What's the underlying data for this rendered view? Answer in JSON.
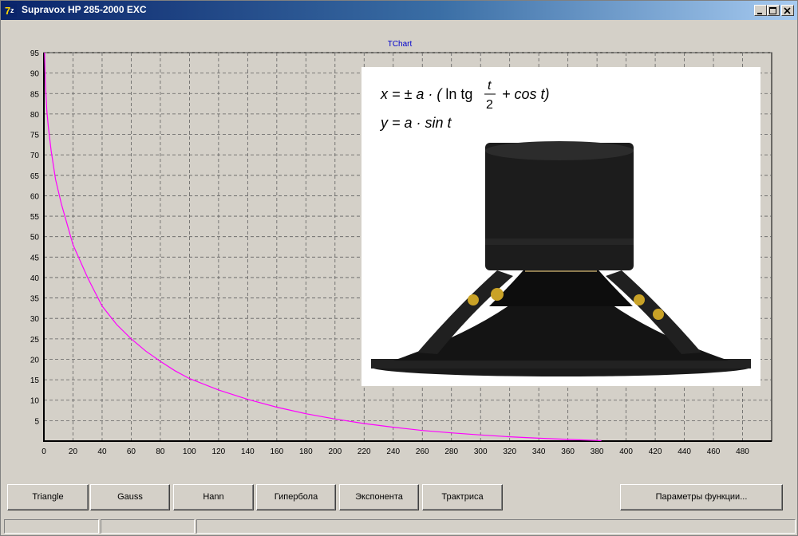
{
  "window": {
    "title": "Supravox HP 285-2000 EXC"
  },
  "chart": {
    "title": "TChart",
    "formula_line1_lhs": "x = ± a · (",
    "formula_line1_mid": "ln tg",
    "formula_frac_num": "t",
    "formula_frac_den": "2",
    "formula_line1_end": "+ cos t)",
    "formula_line2": "y = a · sin t"
  },
  "buttons": {
    "triangle": "Triangle",
    "gauss": "Gauss",
    "hann": "Hann",
    "hyperbola": "Гипербола",
    "exponent": "Экспонента",
    "tractrix": "Трактриса",
    "params": "Параметры функции..."
  },
  "chart_data": {
    "type": "line",
    "title": "TChart",
    "xlabel": "",
    "ylabel": "",
    "xlim": [
      0,
      500
    ],
    "ylim": [
      0,
      95
    ],
    "x_ticks": [
      0,
      20,
      40,
      60,
      80,
      100,
      120,
      140,
      160,
      180,
      200,
      220,
      240,
      260,
      280,
      300,
      320,
      340,
      360,
      380,
      400,
      420,
      440,
      460,
      480
    ],
    "y_ticks": [
      5,
      10,
      15,
      20,
      25,
      30,
      35,
      40,
      45,
      50,
      55,
      60,
      65,
      70,
      75,
      80,
      85,
      90,
      95
    ],
    "grid": true,
    "series": [
      {
        "color": "#ff00ff",
        "points": [
          [
            0.5,
            95
          ],
          [
            1,
            88
          ],
          [
            2,
            81
          ],
          [
            3,
            77
          ],
          [
            5,
            71
          ],
          [
            8,
            64
          ],
          [
            12,
            58
          ],
          [
            16,
            53
          ],
          [
            20,
            48
          ],
          [
            25,
            44
          ],
          [
            30,
            40
          ],
          [
            35,
            36.5
          ],
          [
            40,
            33
          ],
          [
            50,
            28.5
          ],
          [
            60,
            25
          ],
          [
            70,
            22
          ],
          [
            80,
            19.5
          ],
          [
            90,
            17.2
          ],
          [
            100,
            15.3
          ],
          [
            120,
            12.5
          ],
          [
            140,
            10.2
          ],
          [
            160,
            8.3
          ],
          [
            180,
            6.7
          ],
          [
            200,
            5.4
          ],
          [
            220,
            4.3
          ],
          [
            240,
            3.4
          ],
          [
            260,
            2.6
          ],
          [
            280,
            2
          ],
          [
            300,
            1.5
          ],
          [
            320,
            1.05
          ],
          [
            340,
            0.7
          ],
          [
            360,
            0.4
          ],
          [
            380,
            0.15
          ],
          [
            383,
            0.1
          ]
        ]
      }
    ]
  }
}
